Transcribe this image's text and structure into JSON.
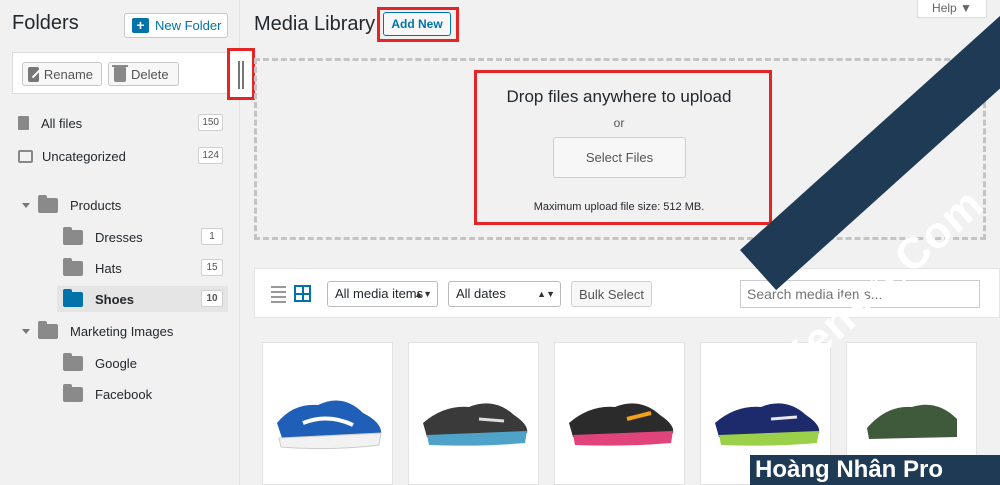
{
  "sidebar": {
    "title": "Folders",
    "new_folder_label": "New Folder",
    "rename_label": "Rename",
    "delete_label": "Delete",
    "all_files": {
      "label": "All files",
      "count": "150"
    },
    "uncategorized": {
      "label": "Uncategorized",
      "count": "124"
    },
    "folders": [
      {
        "label": "Products"
      },
      {
        "label": "Dresses",
        "count": "1"
      },
      {
        "label": "Hats",
        "count": "15"
      },
      {
        "label": "Shoes",
        "count": "10"
      },
      {
        "label": "Marketing Images"
      },
      {
        "label": "Google"
      },
      {
        "label": "Facebook"
      }
    ]
  },
  "header": {
    "title": "Media Library",
    "add_new_label": "Add New",
    "help_label": "Help ▼"
  },
  "upload": {
    "title": "Drop files anywhere to upload",
    "or": "or",
    "select_files_label": "Select Files",
    "max_size": "Maximum upload file size: 512 MB.",
    "close_glyph": "✕"
  },
  "filters": {
    "type_value": "All media items",
    "dates_value": "All dates",
    "bulk_select_label": "Bulk Select",
    "search_placeholder": "Search media items..."
  },
  "watermark": {
    "diagonal": "XenVn.Com",
    "bottom": "Hoàng Nhân Pro"
  },
  "colors": {
    "accent": "#0073aa",
    "highlight": "#e52525"
  }
}
